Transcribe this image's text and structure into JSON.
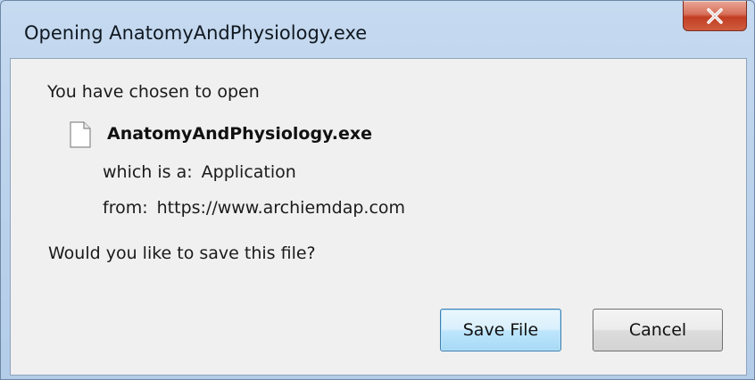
{
  "window": {
    "title": "Opening AnatomyAndPhysiology.exe",
    "close_icon": "close-icon"
  },
  "dialog": {
    "intro": "You have chosen to open",
    "file_icon": "document-icon",
    "filename": "AnatomyAndPhysiology.exe",
    "which_label": "which is a:",
    "which_value": "Application",
    "from_label": "from:",
    "from_value": "https://www.archiemdap.com",
    "question": "Would you like to save this file?"
  },
  "buttons": {
    "save_label": "Save File",
    "cancel_label": "Cancel"
  },
  "colors": {
    "frame": "#b9d1ea",
    "content_bg": "#f0f0f0",
    "close_button": "#c23e23",
    "default_button_border": "#3c7fb1"
  }
}
